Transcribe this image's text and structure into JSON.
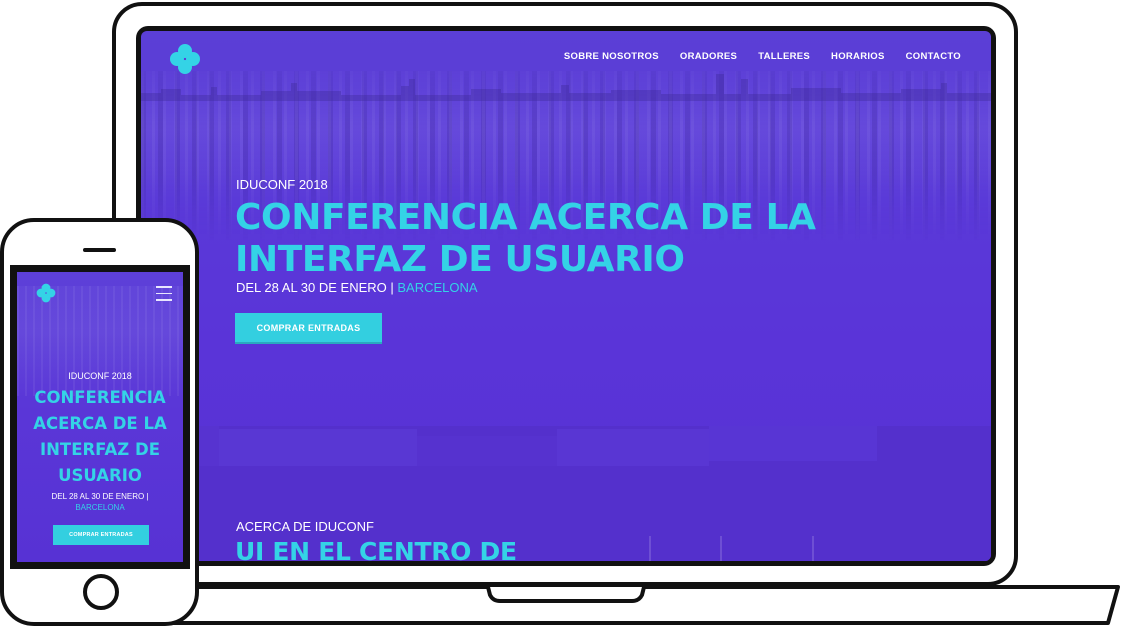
{
  "brand": {
    "accent_color": "#34d3e6",
    "background_color": "#5a36d7",
    "logo_icon": "flower-clover-icon"
  },
  "desktop": {
    "nav": [
      "SOBRE NOSOTROS",
      "ORADORES",
      "TALLERES",
      "HORARIOS",
      "CONTACTO"
    ],
    "hero": {
      "kicker": "IDUCONF 2018",
      "title_line1": "CONFERENCIA ACERCA DE LA",
      "title_line2": "INTERFAZ DE USUARIO",
      "date_text": "DEL 28 AL 30 DE ENERO | ",
      "city": "BARCELONA",
      "cta_label": "COMPRAR ENTRADAS"
    },
    "about": {
      "kicker": "ACERCA DE IDUCONF",
      "title": "UI EN EL CENTRO DE"
    }
  },
  "mobile": {
    "menu_icon": "hamburger-menu-icon",
    "hero": {
      "kicker": "IDUCONF 2018",
      "title_line1": "CONFERENCIA",
      "title_line2": "ACERCA DE LA",
      "title_line3": "INTERFAZ DE",
      "title_line4": "USUARIO",
      "date_text": "DEL 28 AL 30 DE ENERO |",
      "city": "BARCELONA",
      "cta_label": "COMPRAR ENTRADAS"
    }
  }
}
